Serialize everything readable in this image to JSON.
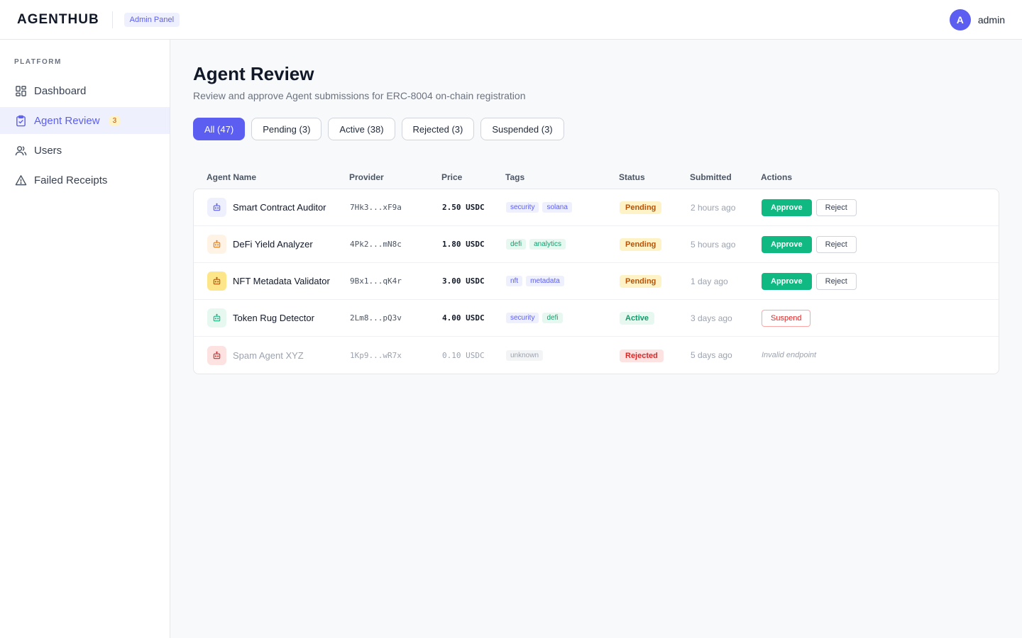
{
  "header": {
    "brand": "AGENTHUB",
    "panel_badge": "Admin Panel",
    "user": {
      "initial": "A",
      "name": "admin"
    }
  },
  "sidebar": {
    "section_label": "PLATFORM",
    "items": [
      {
        "label": "Dashboard",
        "icon": "grid-icon"
      },
      {
        "label": "Agent Review",
        "icon": "clipboard-check-icon",
        "badge": "3",
        "active": true
      },
      {
        "label": "Users",
        "icon": "users-icon"
      },
      {
        "label": "Failed Receipts",
        "icon": "warning-triangle-icon"
      }
    ]
  },
  "page": {
    "title": "Agent Review",
    "subtitle": "Review and approve Agent submissions for ERC-8004 on-chain registration"
  },
  "tabs": [
    {
      "label": "All (47)",
      "active": true
    },
    {
      "label": "Pending (3)"
    },
    {
      "label": "Active (38)"
    },
    {
      "label": "Rejected (3)"
    },
    {
      "label": "Suspended (3)"
    }
  ],
  "table": {
    "columns": [
      "Agent Name",
      "Provider",
      "Price",
      "Tags",
      "Status",
      "Submitted",
      "Actions"
    ],
    "rows": [
      {
        "name": "Smart Contract Auditor",
        "provider": "7Hk3...xF9a",
        "price": "2.50 USDC",
        "tags": [
          "security",
          "solana"
        ],
        "status": "Pending",
        "submitted": "2 hours ago",
        "actions": [
          "Approve",
          "Reject"
        ],
        "icon_color": "#5b5ef0",
        "icon_bg": "#eef0fe"
      },
      {
        "name": "DeFi Yield Analyzer",
        "provider": "4Pk2...mN8c",
        "price": "1.80 USDC",
        "tags": [
          "defi",
          "analytics"
        ],
        "status": "Pending",
        "submitted": "5 hours ago",
        "actions": [
          "Approve",
          "Reject"
        ],
        "icon_color": "#ea7a12",
        "icon_bg": "#fff3e6"
      },
      {
        "name": "NFT Metadata Validator",
        "provider": "9Bx1...qK4r",
        "price": "3.00 USDC",
        "tags": [
          "nft",
          "metadata"
        ],
        "status": "Pending",
        "submitted": "1 day ago",
        "actions": [
          "Approve",
          "Reject"
        ],
        "icon_color": "#b45309",
        "icon_bg": "#fde68a"
      },
      {
        "name": "Token Rug Detector",
        "provider": "2Lm8...pQ3v",
        "price": "4.00 USDC",
        "tags": [
          "security",
          "defi"
        ],
        "status": "Active",
        "submitted": "3 days ago",
        "actions": [
          "Suspend"
        ],
        "icon_color": "#10b981",
        "icon_bg": "#e7f8f1"
      },
      {
        "name": "Spam Agent XYZ",
        "provider": "1Kp9...wR7x",
        "price": "0.10 USDC",
        "tags": [
          "unknown"
        ],
        "status": "Rejected",
        "submitted": "5 days ago",
        "note": "Invalid endpoint",
        "dim": true,
        "icon_color": "#dc2626",
        "icon_bg": "#fde2e2"
      }
    ]
  },
  "colors": {
    "accent": "#5b5ef0",
    "approve": "#10b981",
    "danger": "#dc2626",
    "pending_bg": "#fef3c7",
    "pending_fg": "#b45309"
  }
}
